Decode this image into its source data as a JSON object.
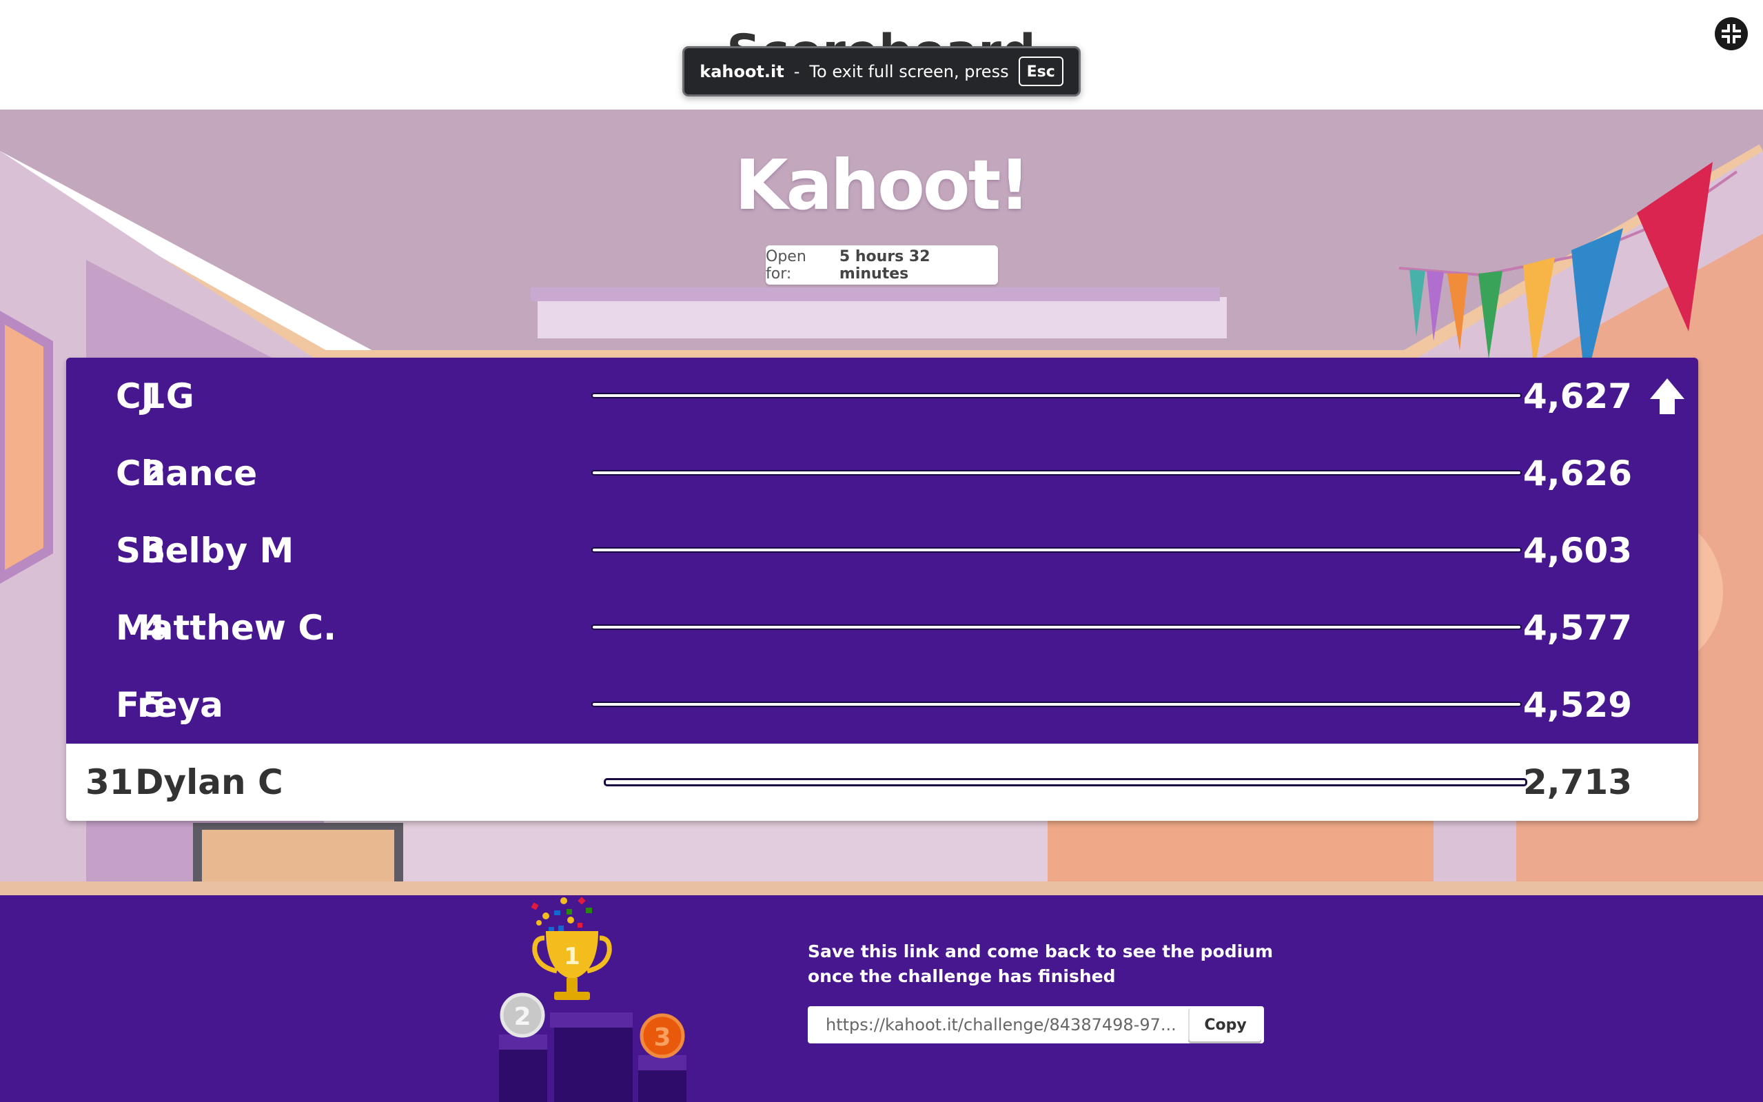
{
  "header": {
    "title": "Scoreboard",
    "fullscreen_notice": {
      "site": "kahoot.it",
      "separator": "-",
      "text": "To exit full screen, press",
      "key": "Esc"
    }
  },
  "logo": "Kahoot!",
  "timer": {
    "label": "Open for:",
    "value": "5 hours 32 minutes"
  },
  "leaderboard": [
    {
      "rank": "1",
      "name": "CJ G",
      "score": "4,627",
      "progress": 1.0
    },
    {
      "rank": "2",
      "name": "Chance",
      "score": "4,626",
      "progress": 1.0
    },
    {
      "rank": "3",
      "name": "Shelby M",
      "score": "4,603",
      "progress": 1.0
    },
    {
      "rank": "4",
      "name": "Matthew C.",
      "score": "4,577",
      "progress": 1.0
    },
    {
      "rank": "5",
      "name": "Freya",
      "score": "4,529",
      "progress": 1.0
    }
  ],
  "current_player": {
    "rank": "31",
    "name": "Dylan C",
    "score": "2,713",
    "progress": 1.0
  },
  "footer": {
    "message_line1": "Save this link and come back to see the podium",
    "message_line2": "once the challenge has finished",
    "link": "https://kahoot.it/challenge/84387498-97...",
    "copy_label": "Copy",
    "podium_numbers": [
      "1",
      "2",
      "3"
    ]
  },
  "colors": {
    "brand_purple": "#46178f",
    "accent_gold": "#f2bd1d",
    "bronze": "#e8590c"
  },
  "icons": [
    "exit-fullscreen-icon",
    "rank-up-arrow-icon",
    "trophy-icon"
  ]
}
